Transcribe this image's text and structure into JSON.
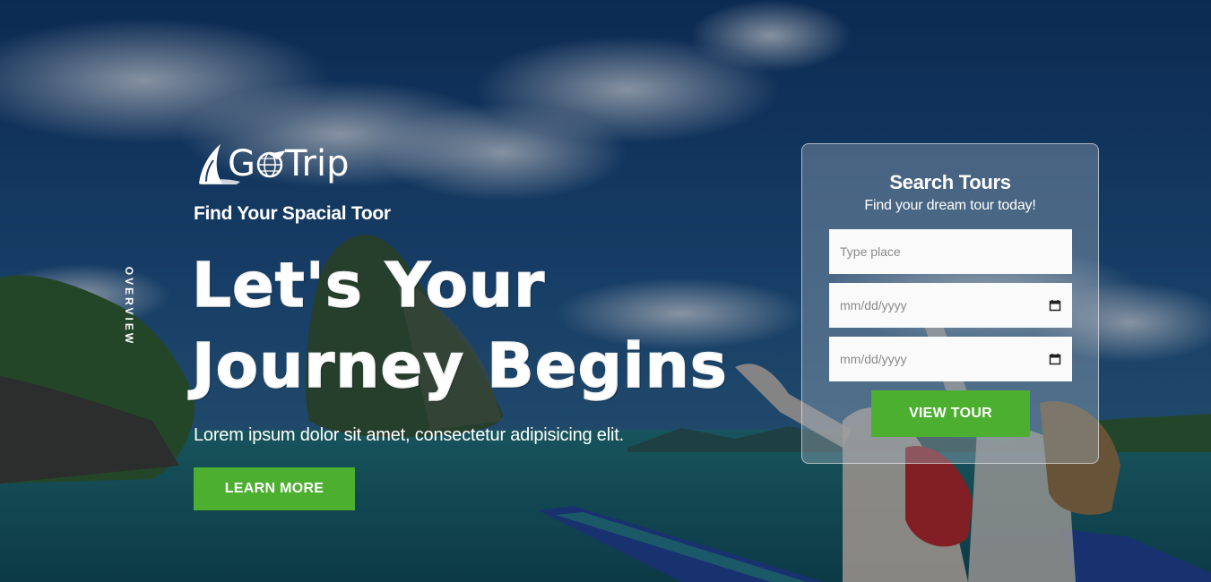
{
  "brand": {
    "logo_text_g": "G",
    "logo_text_rest": "Trip",
    "logo_full": "GoTrip",
    "logo_icon": "sail-icon",
    "globe_icon": "globe-plane-icon"
  },
  "side_label": "OVERVIEW",
  "hero": {
    "tagline": "Find Your Spacial Toor",
    "headline_line1": "Let's Your",
    "headline_line2": "Journey Begins",
    "subtext": "Lorem ipsum dolor sit amet, consectetur adipisicing elit.",
    "cta_label": "LEARN MORE"
  },
  "search": {
    "title": "Search Tours",
    "subtitle": "Find your dream tour today!",
    "place_placeholder": "Type place",
    "date_from_placeholder": "mm/dd/yyyy",
    "date_to_placeholder": "mm/dd/yyyy",
    "date_icon": "calendar-icon",
    "submit_label": "VIEW TOUR"
  },
  "colors": {
    "accent_green": "#4caf2f",
    "text": "#ffffff",
    "field_bg": "#fafafa"
  }
}
